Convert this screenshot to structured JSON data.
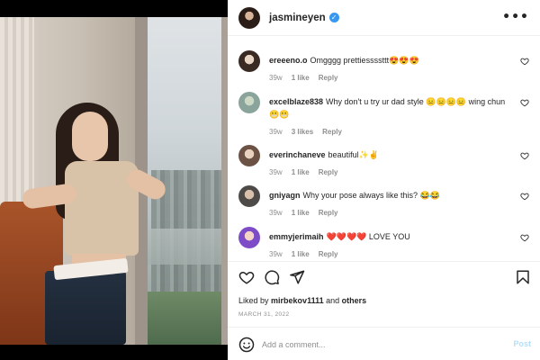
{
  "post": {
    "username": "jasmineyen",
    "verified_mark": "✓",
    "more_label": "•••"
  },
  "comments": [
    {
      "user": "ereeeno.o",
      "text": "Omgggg prettiessssttt😍😍😍",
      "time": "39w",
      "likes": "1 like",
      "reply": "Reply"
    },
    {
      "user": "excelblaze838",
      "text": "Why don't u try ur dad style 😑😑😑😑 wing chun 😬😬",
      "time": "39w",
      "likes": "3 likes",
      "reply": "Reply"
    },
    {
      "user": "everinchaneve",
      "text": "beautiful✨✌️",
      "time": "39w",
      "likes": "1 like",
      "reply": "Reply"
    },
    {
      "user": "gniyagn",
      "text": "Why your pose always like this? 😂😂",
      "time": "39w",
      "likes": "1 like",
      "reply": "Reply"
    },
    {
      "user": "emmyjerimaih",
      "text": "❤️❤️❤️❤️ LOVE YOU",
      "time": "39w",
      "likes": "1 like",
      "reply": "Reply"
    }
  ],
  "likes": {
    "prefix": "Liked by",
    "user": "mirbekov1111",
    "middle": "and",
    "others": "others"
  },
  "date": "MARCH 31, 2022",
  "add_comment": {
    "placeholder": "Add a comment...",
    "post_label": "Post"
  },
  "icons": {
    "like": "heart-icon",
    "comment": "comment-icon",
    "share": "share-icon",
    "save": "bookmark-icon",
    "emoji": "smile-icon",
    "more": "more-icon"
  }
}
